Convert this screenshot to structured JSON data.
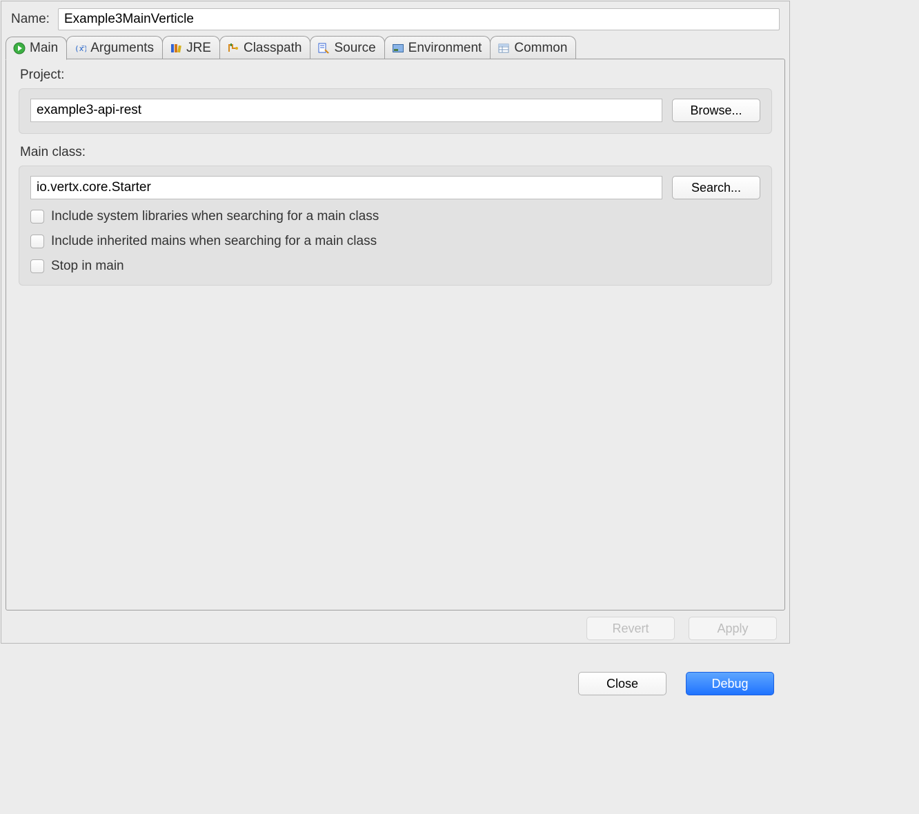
{
  "name": {
    "label": "Name:",
    "value": "Example3MainVerticle"
  },
  "tabs": [
    {
      "label": "Main"
    },
    {
      "label": "Arguments"
    },
    {
      "label": "JRE"
    },
    {
      "label": "Classpath"
    },
    {
      "label": "Source"
    },
    {
      "label": "Environment"
    },
    {
      "label": "Common"
    }
  ],
  "main": {
    "project": {
      "label": "Project:",
      "value": "example3-api-rest",
      "browse": "Browse..."
    },
    "mainclass": {
      "label": "Main class:",
      "value": "io.vertx.core.Starter",
      "search": "Search..."
    },
    "checks": {
      "syslib": "Include system libraries when searching for a main class",
      "inherited": "Include inherited mains when searching for a main class",
      "stop": "Stop in main"
    }
  },
  "buttons": {
    "revert": "Revert",
    "apply": "Apply",
    "close": "Close",
    "debug": "Debug"
  }
}
